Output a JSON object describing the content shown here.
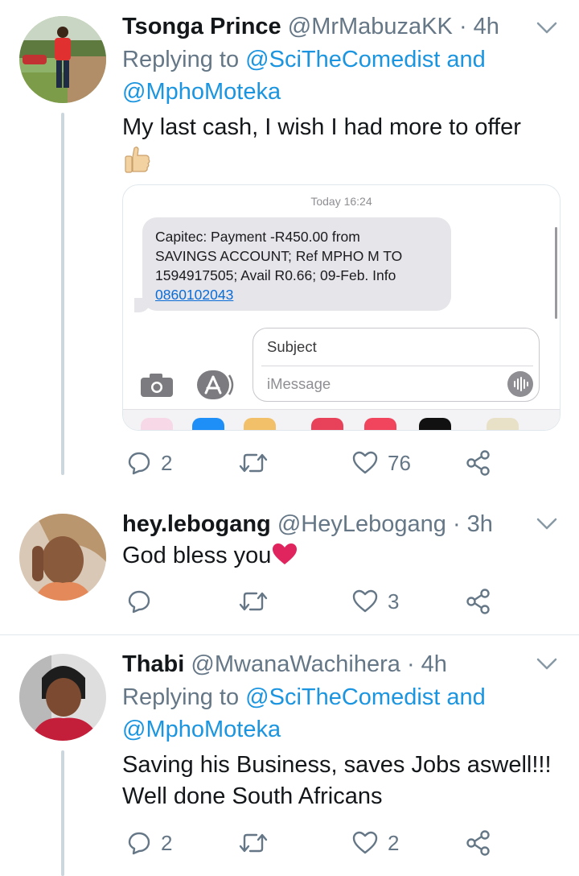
{
  "tweets": [
    {
      "display_name": "Tsonga Prince",
      "handle": "@MrMabuzaKK",
      "time": "· 4h",
      "replying_prefix": "Replying to",
      "replying_user1": "@SciTheComedist",
      "replying_and": "and",
      "replying_user2": "@MphoMoteka",
      "text": "My last cash, I wish I had more to offer",
      "emoji_icon": "thumbs-up-icon",
      "replies": "2",
      "retweets": "",
      "likes": "76",
      "embed": {
        "time_label": "Today 16:24",
        "sms_line1": "Capitec: Payment -R450.00 from",
        "sms_line2": "SAVINGS ACCOUNT; Ref MPHO M TO",
        "sms_line3": "1594917505; Avail R0.66; 09-Feb. Info",
        "sms_phone": "0860102043",
        "subject_placeholder": "Subject",
        "message_placeholder": "iMessage"
      }
    },
    {
      "display_name": "hey.lebogang",
      "handle": "@HeyLebogang",
      "time": "· 3h",
      "text": "God bless you",
      "emoji_icon": "red-heart-icon",
      "replies": "",
      "retweets": "",
      "likes": "3"
    },
    {
      "display_name": "Thabi",
      "handle": "@MwanaWachihera",
      "time": "· 4h",
      "replying_prefix": "Replying to",
      "replying_user1": "@SciTheComedist",
      "replying_and": "and",
      "replying_user2": "@MphoMoteka",
      "text_line1": "Saving his Business, saves Jobs aswell!!!",
      "text_line2": "Well done South Africans",
      "replies": "2",
      "retweets": "",
      "likes": "2"
    }
  ],
  "colors": {
    "text": "#14171a",
    "muted": "#657786",
    "link": "#1b95e0",
    "thread_line": "#ccd6dd",
    "heart": "#e0245e"
  }
}
